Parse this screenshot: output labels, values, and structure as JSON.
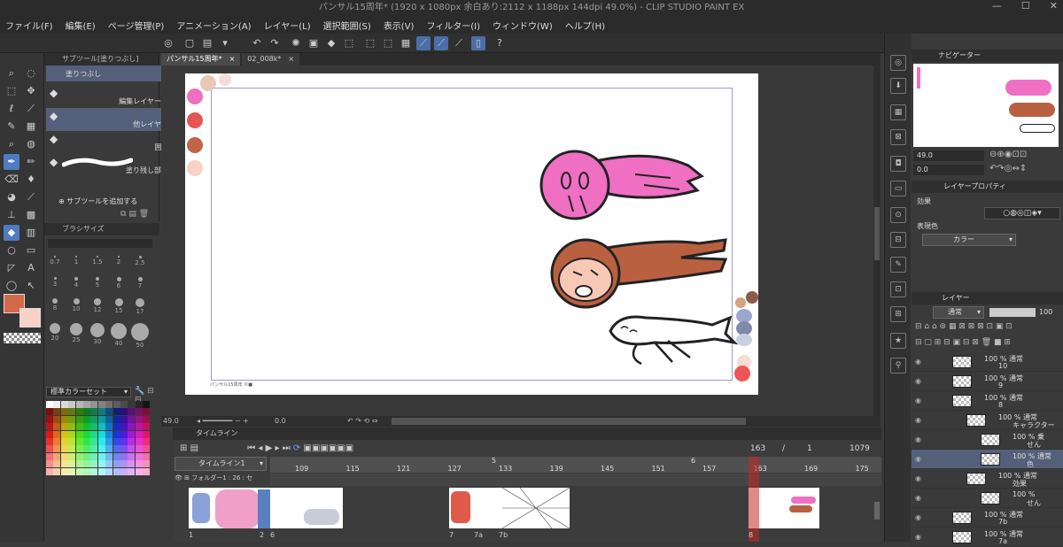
{
  "window": {
    "title": "パンサル15周年* (1920 x 1080px 余白あり:2112 x 1188px 144dpi 49.0%) - CLIP STUDIO PAINT EX",
    "min": "—",
    "max": "☐",
    "close": "✕"
  },
  "menu": [
    "ファイル(F)",
    "編集(E)",
    "ページ管理(P)",
    "アニメーション(A)",
    "レイヤー(L)",
    "選択範囲(S)",
    "表示(V)",
    "フィルター(I)",
    "ウィンドウ(W)",
    "ヘルプ(H)"
  ],
  "tabs": [
    {
      "label": "パンサル15周年*",
      "close": "×"
    },
    {
      "label": "02_008k*",
      "close": "×"
    }
  ],
  "subtool": {
    "title": "サブツール[塗りつぶし]",
    "group": "塗りつぶし",
    "items": [
      "編集レイヤーのみ参照",
      "他レイヤーを参照",
      "囲って塗る",
      "塗り残し部分に塗る"
    ],
    "add": "サブツールを追加する"
  },
  "brushsize": {
    "title": "ブラシサイズ",
    "sizes": [
      "0.7",
      "1",
      "1.5",
      "2",
      "2.5",
      "3",
      "4",
      "5",
      "6",
      "7",
      "8",
      "10",
      "12",
      "15",
      "17",
      "20",
      "25",
      "30",
      "40",
      "50"
    ]
  },
  "colorset": {
    "title": "標準カラーセット"
  },
  "canvas": {
    "credit": "パンサル15周年 ©■"
  },
  "status": {
    "zoom": "49.0",
    "angle": "0.0"
  },
  "timeline": {
    "title": "タイムライン",
    "current": "163",
    "sep": "/",
    "start": "1",
    "end": "1079",
    "name": "タイムライン1",
    "folder": "フォルダー1 : 26 : セ",
    "ruler": [
      "109",
      "115",
      "121",
      "127",
      "133",
      "139",
      "145",
      "151",
      "157",
      "163",
      "169",
      "175"
    ],
    "markers": [
      "5",
      "6",
      "7"
    ],
    "cells": [
      "1",
      "2",
      "6",
      "7",
      "7a",
      "7b",
      "8"
    ]
  },
  "navigator": {
    "title": "ナビゲーター",
    "zoom": "49.0",
    "angle": "0.0"
  },
  "layerprop": {
    "title": "レイヤープロパティ",
    "effect": "効果",
    "expr": "表現色",
    "color": "カラー"
  },
  "layer": {
    "title": "レイヤー",
    "blend": "通常",
    "opacity": "100",
    "rows": [
      {
        "label": "100 % 通常",
        "sub": "10"
      },
      {
        "label": "100 % 通常",
        "sub": "9"
      },
      {
        "label": "100 % 通常",
        "sub": "8"
      },
      {
        "label": "100 % 通常",
        "sub": "キャラクター"
      },
      {
        "label": "100 % 乗",
        "sub": "せん"
      },
      {
        "label": "100 % 通常",
        "sub": "色"
      },
      {
        "label": "100 % 通常",
        "sub": "効果"
      },
      {
        "label": "100 %",
        "sub": "せん"
      },
      {
        "label": "100 % 通常",
        "sub": "7b"
      },
      {
        "label": "100 % 通常",
        "sub": "7a"
      }
    ]
  },
  "colors": {
    "main": "#d2694a",
    "sub": "#f7d2c5",
    "pink": "#ef6fc3",
    "brown": "#b86040"
  }
}
